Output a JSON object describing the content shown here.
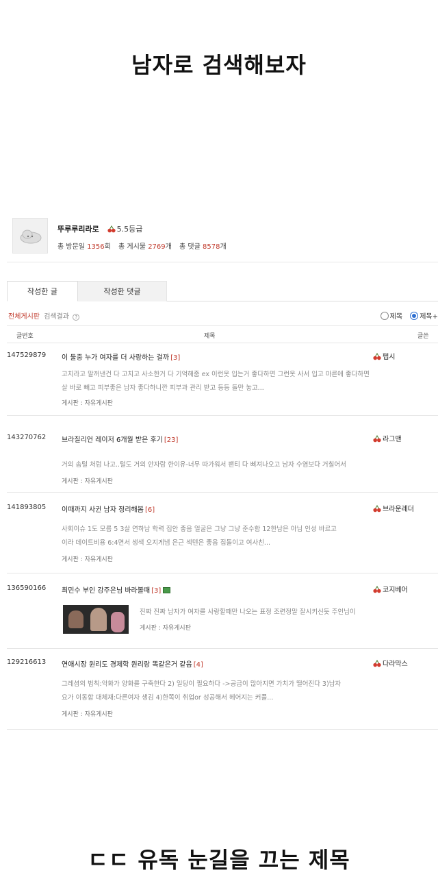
{
  "captions": {
    "top": "남자로 검색해보자",
    "bottom": "ㄷㄷ 유독 눈길을 끄는 제목"
  },
  "profile": {
    "nickname": "뚜루루리라로",
    "level": "5.5등급",
    "visits_label": "총 방문일",
    "visits": "1356",
    "visits_unit": "회",
    "posts_label": "총 게시물",
    "posts": "2769",
    "posts_unit": "개",
    "comments_label": "총 댓글",
    "comments": "8578",
    "comments_unit": "개"
  },
  "tabs": {
    "posts": "작성한 글",
    "comments": "작성한 댓글"
  },
  "filter": {
    "board_link": "전체게시판",
    "result_label": "검색결과",
    "help": "?",
    "option_title": "제목",
    "option_title_content": "제목+"
  },
  "columns": {
    "no": "글번호",
    "title": "제목",
    "author": "글쓴"
  },
  "posts": [
    {
      "id": "147529879",
      "title": "이 둘중 누가 여자를 더 사랑하는 걸까",
      "comments": "[3]",
      "author": "펩시",
      "excerpt1": "고치라고 말꺼낸건 다 고치고 사소한거 다 기억해줌 ex 이런옷 입는거 좋다하면 그런옷 사서 입고 마른애 좋다하면",
      "excerpt2": "살 바로 빼고 피부좋은 남자 좋다하니깐 피부과 관리 받고 등등 돌만 놓고...",
      "board": "게시판 : 자유게시판"
    },
    {
      "id": "143270762",
      "title": "브라질리언 레이저 6개월 받은 후기",
      "comments": "[23]",
      "author": "라그맨",
      "excerpt1": "거의 솜털 처럼 나고..털도 거의 안자람 한이유-너무 따가워서 팬티 다 삐져나오고 남자 수염보다 거칠어서",
      "board": "게시판 : 자유게시판"
    },
    {
      "id": "141893805",
      "title": "이때까지 사귄 남자 정리해봄",
      "comments": "[6]",
      "author": "브라운레더",
      "excerpt1": "사회이슈 1도 모름 5 3살 연하남 학력 집안 좋음 얼굴은 그냥 그냥 준수함 12한남은 아님 인성 바르고 ",
      "excerpt2": "이라 데이트비용 6:4면서 생색 오지게냄 은근 섹텐은 좋음 집돌이고 여사친...",
      "board": "게시판 : 자유게시판"
    },
    {
      "id": "136590166",
      "title": "최민수 부인 강주은님 바라볼때",
      "comments": "[3]",
      "author": "코지베어",
      "excerpt1": "진짜 진짜 남자가 여자를 사랑할때만 나오는 표정 조련정말 잘시키신듯 주인님이 ",
      "board": "게시판 : 자유게시판"
    },
    {
      "id": "129216613",
      "title": "연애시장 원리도 경제학 원리랑 똑같은거 같음",
      "comments": "[4]",
      "author": "다라막스",
      "excerpt1": "그레셤의 법칙:악화가 양화를 구축한다 2) 일당이 필요하다 ->공급이 많아지면 가치가 떨어진다 3)남자",
      "excerpt2": "요가 이동함 대체재:다른여자 생김 4)한쪽이 취업or 성공해서 헤어지는 커플...",
      "board": "게시판 : 자유게시판"
    }
  ]
}
